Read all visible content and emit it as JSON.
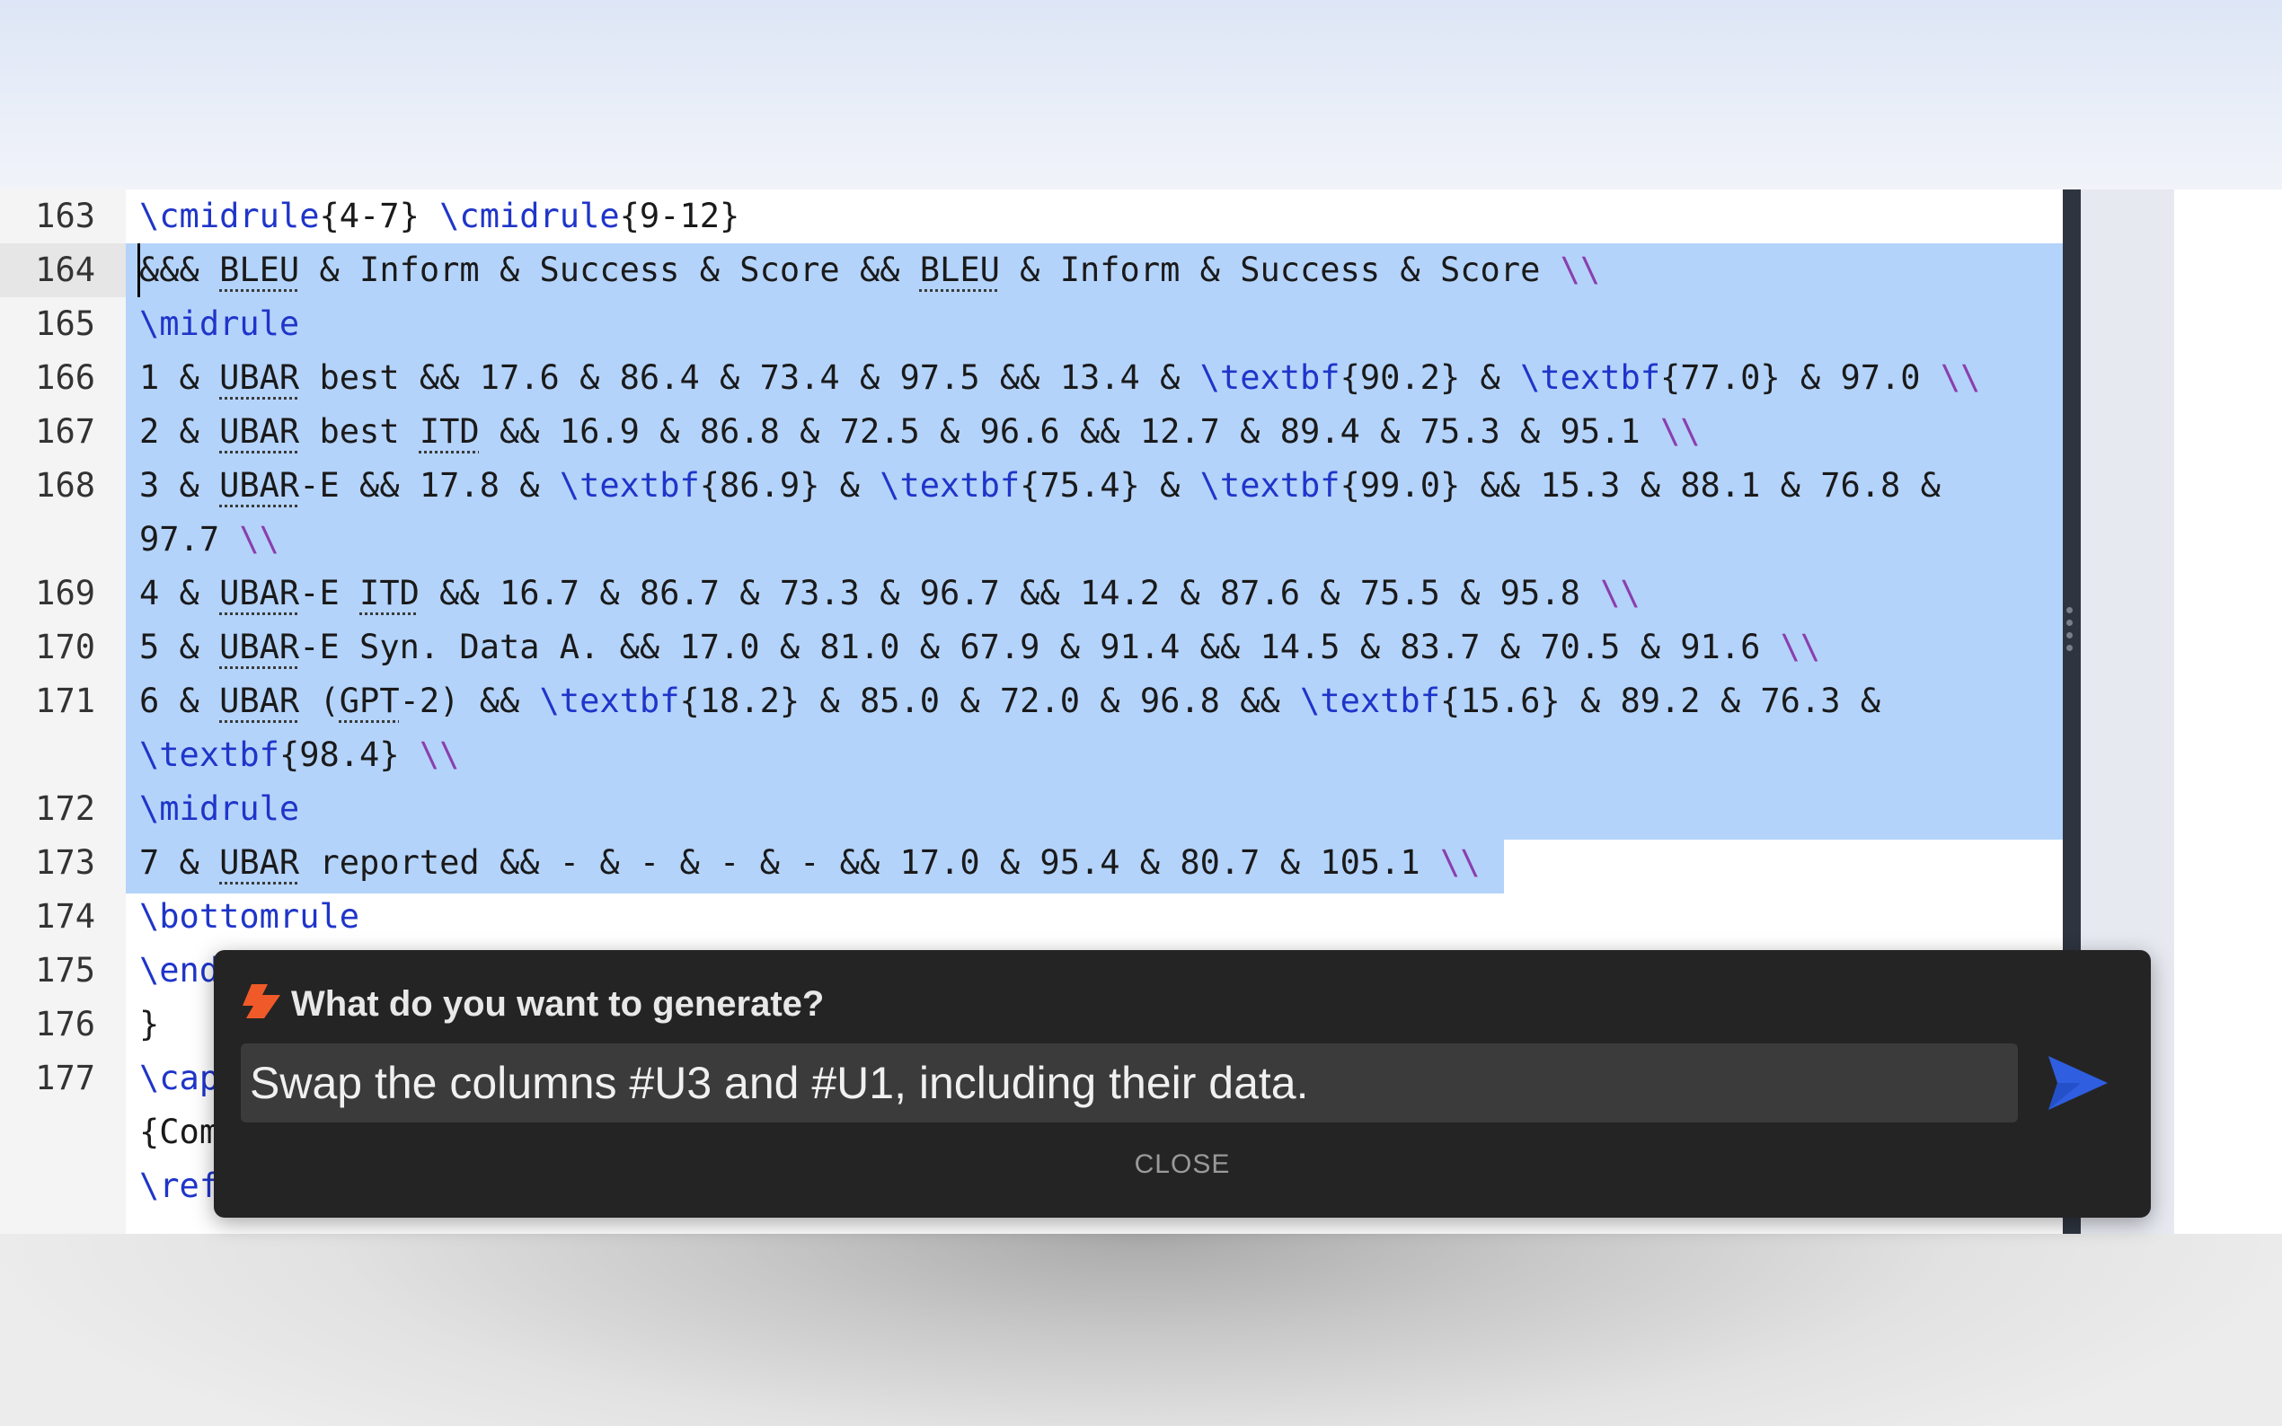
{
  "editor": {
    "lines": [
      {
        "no": "163",
        "segments": [
          [
            "cmd",
            "\\cmidrule"
          ],
          [
            "t",
            "{4-7} "
          ],
          [
            "cmd",
            "\\cmidrule"
          ],
          [
            "t",
            "{9-12}"
          ]
        ]
      },
      {
        "no": "164",
        "segments": [
          [
            "t",
            "&&& "
          ],
          [
            "ul",
            "BLEU"
          ],
          [
            "t",
            " & Inform & Success & Score && "
          ],
          [
            "ul",
            "BLEU"
          ],
          [
            "t",
            " & Inform & Success & Score "
          ],
          [
            "bs",
            "\\\\"
          ]
        ]
      },
      {
        "no": "165",
        "segments": [
          [
            "cmd",
            "\\midrule"
          ]
        ]
      },
      {
        "no": "166",
        "segments": [
          [
            "t",
            "1 & "
          ],
          [
            "ul",
            "UBAR"
          ],
          [
            "t",
            " best && 17.6 & 86.4 & 73.4 & 97.5 && 13.4 & "
          ],
          [
            "cmd",
            "\\textbf"
          ],
          [
            "t",
            "{90.2} & "
          ],
          [
            "cmd",
            "\\textbf"
          ],
          [
            "t",
            "{77.0} & 97.0 "
          ],
          [
            "bs",
            "\\\\"
          ]
        ]
      },
      {
        "no": "167",
        "segments": [
          [
            "t",
            "2 & "
          ],
          [
            "ul",
            "UBAR"
          ],
          [
            "t",
            " best "
          ],
          [
            "ul",
            "ITD"
          ],
          [
            "t",
            " && 16.9 & 86.8 & 72.5 & 96.6 && 12.7 & 89.4 & 75.3 & 95.1 "
          ],
          [
            "bs",
            "\\\\"
          ]
        ]
      },
      {
        "no": "168",
        "segments": [
          [
            "t",
            "3 & "
          ],
          [
            "ul",
            "UBAR"
          ],
          [
            "t",
            "-E && 17.8 & "
          ],
          [
            "cmd",
            "\\textbf"
          ],
          [
            "t",
            "{86.9} & "
          ],
          [
            "cmd",
            "\\textbf"
          ],
          [
            "t",
            "{75.4} & "
          ],
          [
            "cmd",
            "\\textbf"
          ],
          [
            "t",
            "{99.0} && 15.3 & 88.1 & 76.8 &"
          ]
        ]
      },
      {
        "no": "",
        "segments": [
          [
            "t",
            "97.7 "
          ],
          [
            "bs",
            "\\\\"
          ]
        ]
      },
      {
        "no": "169",
        "segments": [
          [
            "t",
            "4 & "
          ],
          [
            "ul",
            "UBAR"
          ],
          [
            "t",
            "-E "
          ],
          [
            "ul",
            "ITD"
          ],
          [
            "t",
            " && 16.7 & 86.7 & 73.3 & 96.7 && 14.2 & 87.6 & 75.5 & 95.8 "
          ],
          [
            "bs",
            "\\\\"
          ]
        ]
      },
      {
        "no": "170",
        "segments": [
          [
            "t",
            "5 & "
          ],
          [
            "ul",
            "UBAR"
          ],
          [
            "t",
            "-E Syn. Data A. && 17.0 & 81.0 & 67.9 & 91.4 && 14.5 & 83.7 & 70.5 & 91.6 "
          ],
          [
            "bs",
            "\\\\"
          ]
        ]
      },
      {
        "no": "171",
        "segments": [
          [
            "t",
            "6 & "
          ],
          [
            "ul",
            "UBAR"
          ],
          [
            "t",
            " ("
          ],
          [
            "ul",
            "GPT"
          ],
          [
            "t",
            "-2) && "
          ],
          [
            "cmd",
            "\\textbf"
          ],
          [
            "t",
            "{18.2} & 85.0 & 72.0 & 96.8 && "
          ],
          [
            "cmd",
            "\\textbf"
          ],
          [
            "t",
            "{15.6} & 89.2 & 76.3 &"
          ]
        ]
      },
      {
        "no": "",
        "segments": [
          [
            "cmd",
            "\\textbf"
          ],
          [
            "t",
            "{98.4} "
          ],
          [
            "bs",
            "\\\\"
          ]
        ]
      },
      {
        "no": "172",
        "segments": [
          [
            "cmd",
            "\\midrule"
          ]
        ]
      },
      {
        "no": "173",
        "segments": [
          [
            "t",
            "7 & "
          ],
          [
            "ul",
            "UBAR"
          ],
          [
            "t",
            " reported && - & - & - & - && 17.0 & 95.4 & 80.7 & 105.1 "
          ],
          [
            "bs",
            "\\\\"
          ]
        ]
      },
      {
        "no": "174",
        "segments": [
          [
            "cmd",
            "\\bottomrule"
          ]
        ]
      },
      {
        "no": "175",
        "segments": [
          [
            "cmd",
            "\\end"
          ]
        ]
      },
      {
        "no": "176",
        "segments": [
          [
            "t",
            "}"
          ]
        ]
      },
      {
        "no": "177",
        "segments": [
          [
            "cmd",
            "\\cap"
          ]
        ]
      },
      {
        "no": "",
        "segments": [
          [
            "t",
            "{Com"
          ]
        ]
      },
      {
        "no": "",
        "segments": [
          [
            "cmd",
            "\\ref"
          ]
        ]
      }
    ]
  },
  "dialog": {
    "title": "What do you want to generate?",
    "input_value": "Swap the columns #U3 and #U1, including their data.",
    "close_label": "CLOSE",
    "icon": "ai-spark-icon",
    "send_icon": "send-icon",
    "accent_color": "#f05a28",
    "send_color": "#2f5fe0"
  }
}
